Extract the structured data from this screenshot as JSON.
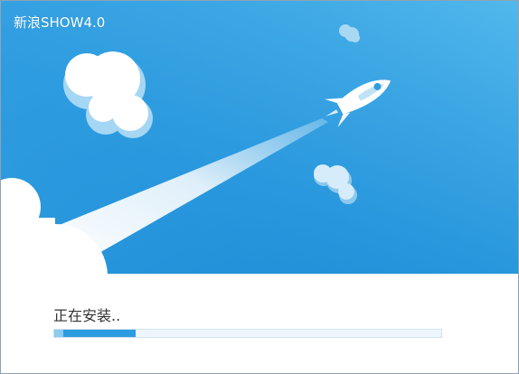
{
  "window": {
    "title": "新浪SHOW4.0"
  },
  "installer": {
    "status_text": "正在安装..",
    "progress_fraction": 0.21
  },
  "colors": {
    "sky_top": "#4bb4ea",
    "sky_bottom": "#1f8fd8",
    "cloud": "#ffffff",
    "cloud_shadow": "#9ed2f2",
    "progress_fill": "#2b9ce0",
    "progress_track": "#eef6fc"
  },
  "icons": [
    "rocket-icon",
    "cloud-icon"
  ]
}
